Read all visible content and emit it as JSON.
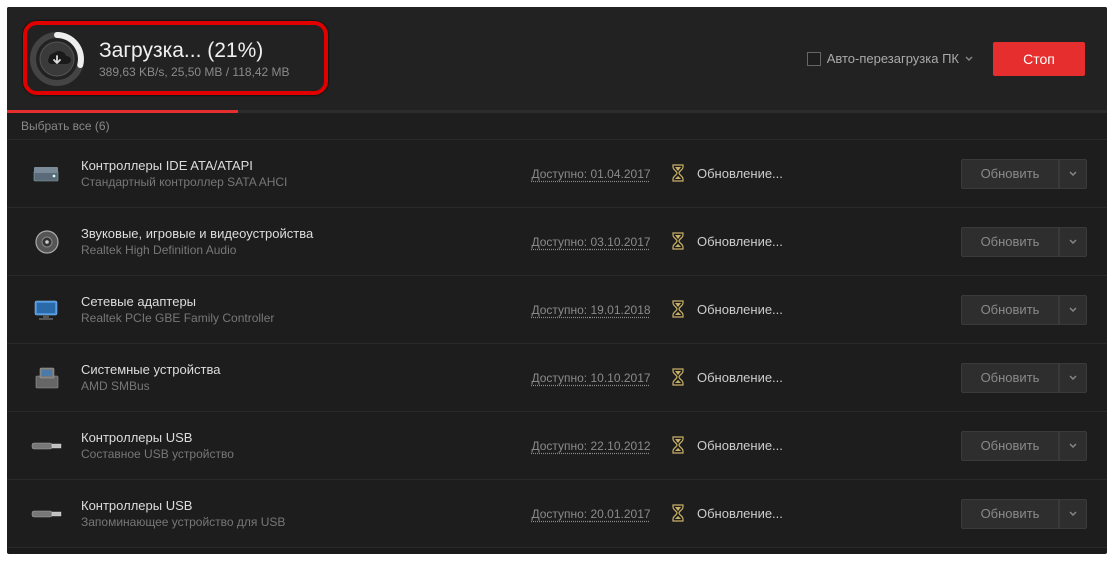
{
  "header": {
    "title": "Загрузка... (21%)",
    "subtitle": "389,63 KB/s, 25,50 MB / 118,42 MB",
    "progress_percent": 21,
    "auto_restart_label": "Авто-перезагрузка ПК",
    "stop_label": "Стоп"
  },
  "select_all": {
    "label": "Выбрать все (6)"
  },
  "column_labels": {
    "available_prefix": "Доступно:",
    "status_updating": "Обновление...",
    "update_button": "Обновить"
  },
  "drivers": [
    {
      "category": "Контроллеры IDE ATA/ATAPI",
      "name": "Стандартный контроллер SATA AHCI",
      "date": "01.04.2017",
      "icon": "storage"
    },
    {
      "category": "Звуковые, игровые и видеоустройства",
      "name": "Realtek High Definition Audio",
      "date": "03.10.2017",
      "icon": "audio"
    },
    {
      "category": "Сетевые адаптеры",
      "name": "Realtek PCIe GBE Family Controller",
      "date": "19.01.2018",
      "icon": "network"
    },
    {
      "category": "Системные устройства",
      "name": "AMD SMBus",
      "date": "10.10.2017",
      "icon": "system"
    },
    {
      "category": "Контроллеры USB",
      "name": "Составное USB устройство",
      "date": "22.10.2012",
      "icon": "usb"
    },
    {
      "category": "Контроллеры USB",
      "name": "Запоминающее устройство для USB",
      "date": "20.01.2017",
      "icon": "usb"
    }
  ]
}
